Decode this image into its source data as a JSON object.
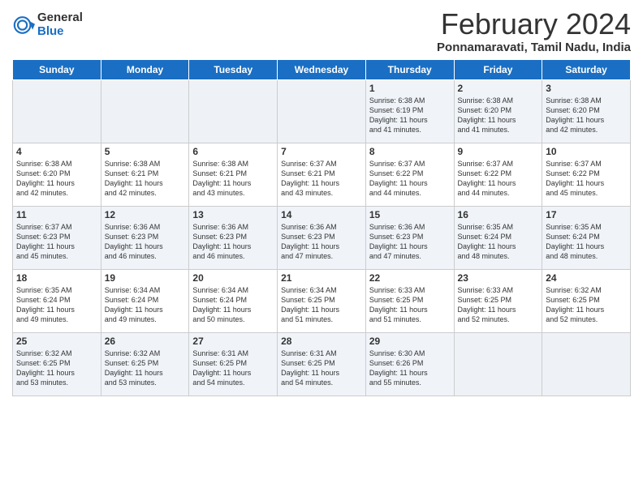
{
  "logo": {
    "general": "General",
    "blue": "Blue"
  },
  "title": "February 2024",
  "subtitle": "Ponnamaravati, Tamil Nadu, India",
  "days_of_week": [
    "Sunday",
    "Monday",
    "Tuesday",
    "Wednesday",
    "Thursday",
    "Friday",
    "Saturday"
  ],
  "weeks": [
    [
      {
        "day": "",
        "info": ""
      },
      {
        "day": "",
        "info": ""
      },
      {
        "day": "",
        "info": ""
      },
      {
        "day": "",
        "info": ""
      },
      {
        "day": "1",
        "info": "Sunrise: 6:38 AM\nSunset: 6:19 PM\nDaylight: 11 hours\nand 41 minutes."
      },
      {
        "day": "2",
        "info": "Sunrise: 6:38 AM\nSunset: 6:20 PM\nDaylight: 11 hours\nand 41 minutes."
      },
      {
        "day": "3",
        "info": "Sunrise: 6:38 AM\nSunset: 6:20 PM\nDaylight: 11 hours\nand 42 minutes."
      }
    ],
    [
      {
        "day": "4",
        "info": "Sunrise: 6:38 AM\nSunset: 6:20 PM\nDaylight: 11 hours\nand 42 minutes."
      },
      {
        "day": "5",
        "info": "Sunrise: 6:38 AM\nSunset: 6:21 PM\nDaylight: 11 hours\nand 42 minutes."
      },
      {
        "day": "6",
        "info": "Sunrise: 6:38 AM\nSunset: 6:21 PM\nDaylight: 11 hours\nand 43 minutes."
      },
      {
        "day": "7",
        "info": "Sunrise: 6:37 AM\nSunset: 6:21 PM\nDaylight: 11 hours\nand 43 minutes."
      },
      {
        "day": "8",
        "info": "Sunrise: 6:37 AM\nSunset: 6:22 PM\nDaylight: 11 hours\nand 44 minutes."
      },
      {
        "day": "9",
        "info": "Sunrise: 6:37 AM\nSunset: 6:22 PM\nDaylight: 11 hours\nand 44 minutes."
      },
      {
        "day": "10",
        "info": "Sunrise: 6:37 AM\nSunset: 6:22 PM\nDaylight: 11 hours\nand 45 minutes."
      }
    ],
    [
      {
        "day": "11",
        "info": "Sunrise: 6:37 AM\nSunset: 6:23 PM\nDaylight: 11 hours\nand 45 minutes."
      },
      {
        "day": "12",
        "info": "Sunrise: 6:36 AM\nSunset: 6:23 PM\nDaylight: 11 hours\nand 46 minutes."
      },
      {
        "day": "13",
        "info": "Sunrise: 6:36 AM\nSunset: 6:23 PM\nDaylight: 11 hours\nand 46 minutes."
      },
      {
        "day": "14",
        "info": "Sunrise: 6:36 AM\nSunset: 6:23 PM\nDaylight: 11 hours\nand 47 minutes."
      },
      {
        "day": "15",
        "info": "Sunrise: 6:36 AM\nSunset: 6:23 PM\nDaylight: 11 hours\nand 47 minutes."
      },
      {
        "day": "16",
        "info": "Sunrise: 6:35 AM\nSunset: 6:24 PM\nDaylight: 11 hours\nand 48 minutes."
      },
      {
        "day": "17",
        "info": "Sunrise: 6:35 AM\nSunset: 6:24 PM\nDaylight: 11 hours\nand 48 minutes."
      }
    ],
    [
      {
        "day": "18",
        "info": "Sunrise: 6:35 AM\nSunset: 6:24 PM\nDaylight: 11 hours\nand 49 minutes."
      },
      {
        "day": "19",
        "info": "Sunrise: 6:34 AM\nSunset: 6:24 PM\nDaylight: 11 hours\nand 49 minutes."
      },
      {
        "day": "20",
        "info": "Sunrise: 6:34 AM\nSunset: 6:24 PM\nDaylight: 11 hours\nand 50 minutes."
      },
      {
        "day": "21",
        "info": "Sunrise: 6:34 AM\nSunset: 6:25 PM\nDaylight: 11 hours\nand 51 minutes."
      },
      {
        "day": "22",
        "info": "Sunrise: 6:33 AM\nSunset: 6:25 PM\nDaylight: 11 hours\nand 51 minutes."
      },
      {
        "day": "23",
        "info": "Sunrise: 6:33 AM\nSunset: 6:25 PM\nDaylight: 11 hours\nand 52 minutes."
      },
      {
        "day": "24",
        "info": "Sunrise: 6:32 AM\nSunset: 6:25 PM\nDaylight: 11 hours\nand 52 minutes."
      }
    ],
    [
      {
        "day": "25",
        "info": "Sunrise: 6:32 AM\nSunset: 6:25 PM\nDaylight: 11 hours\nand 53 minutes."
      },
      {
        "day": "26",
        "info": "Sunrise: 6:32 AM\nSunset: 6:25 PM\nDaylight: 11 hours\nand 53 minutes."
      },
      {
        "day": "27",
        "info": "Sunrise: 6:31 AM\nSunset: 6:25 PM\nDaylight: 11 hours\nand 54 minutes."
      },
      {
        "day": "28",
        "info": "Sunrise: 6:31 AM\nSunset: 6:25 PM\nDaylight: 11 hours\nand 54 minutes."
      },
      {
        "day": "29",
        "info": "Sunrise: 6:30 AM\nSunset: 6:26 PM\nDaylight: 11 hours\nand 55 minutes."
      },
      {
        "day": "",
        "info": ""
      },
      {
        "day": "",
        "info": ""
      }
    ]
  ]
}
